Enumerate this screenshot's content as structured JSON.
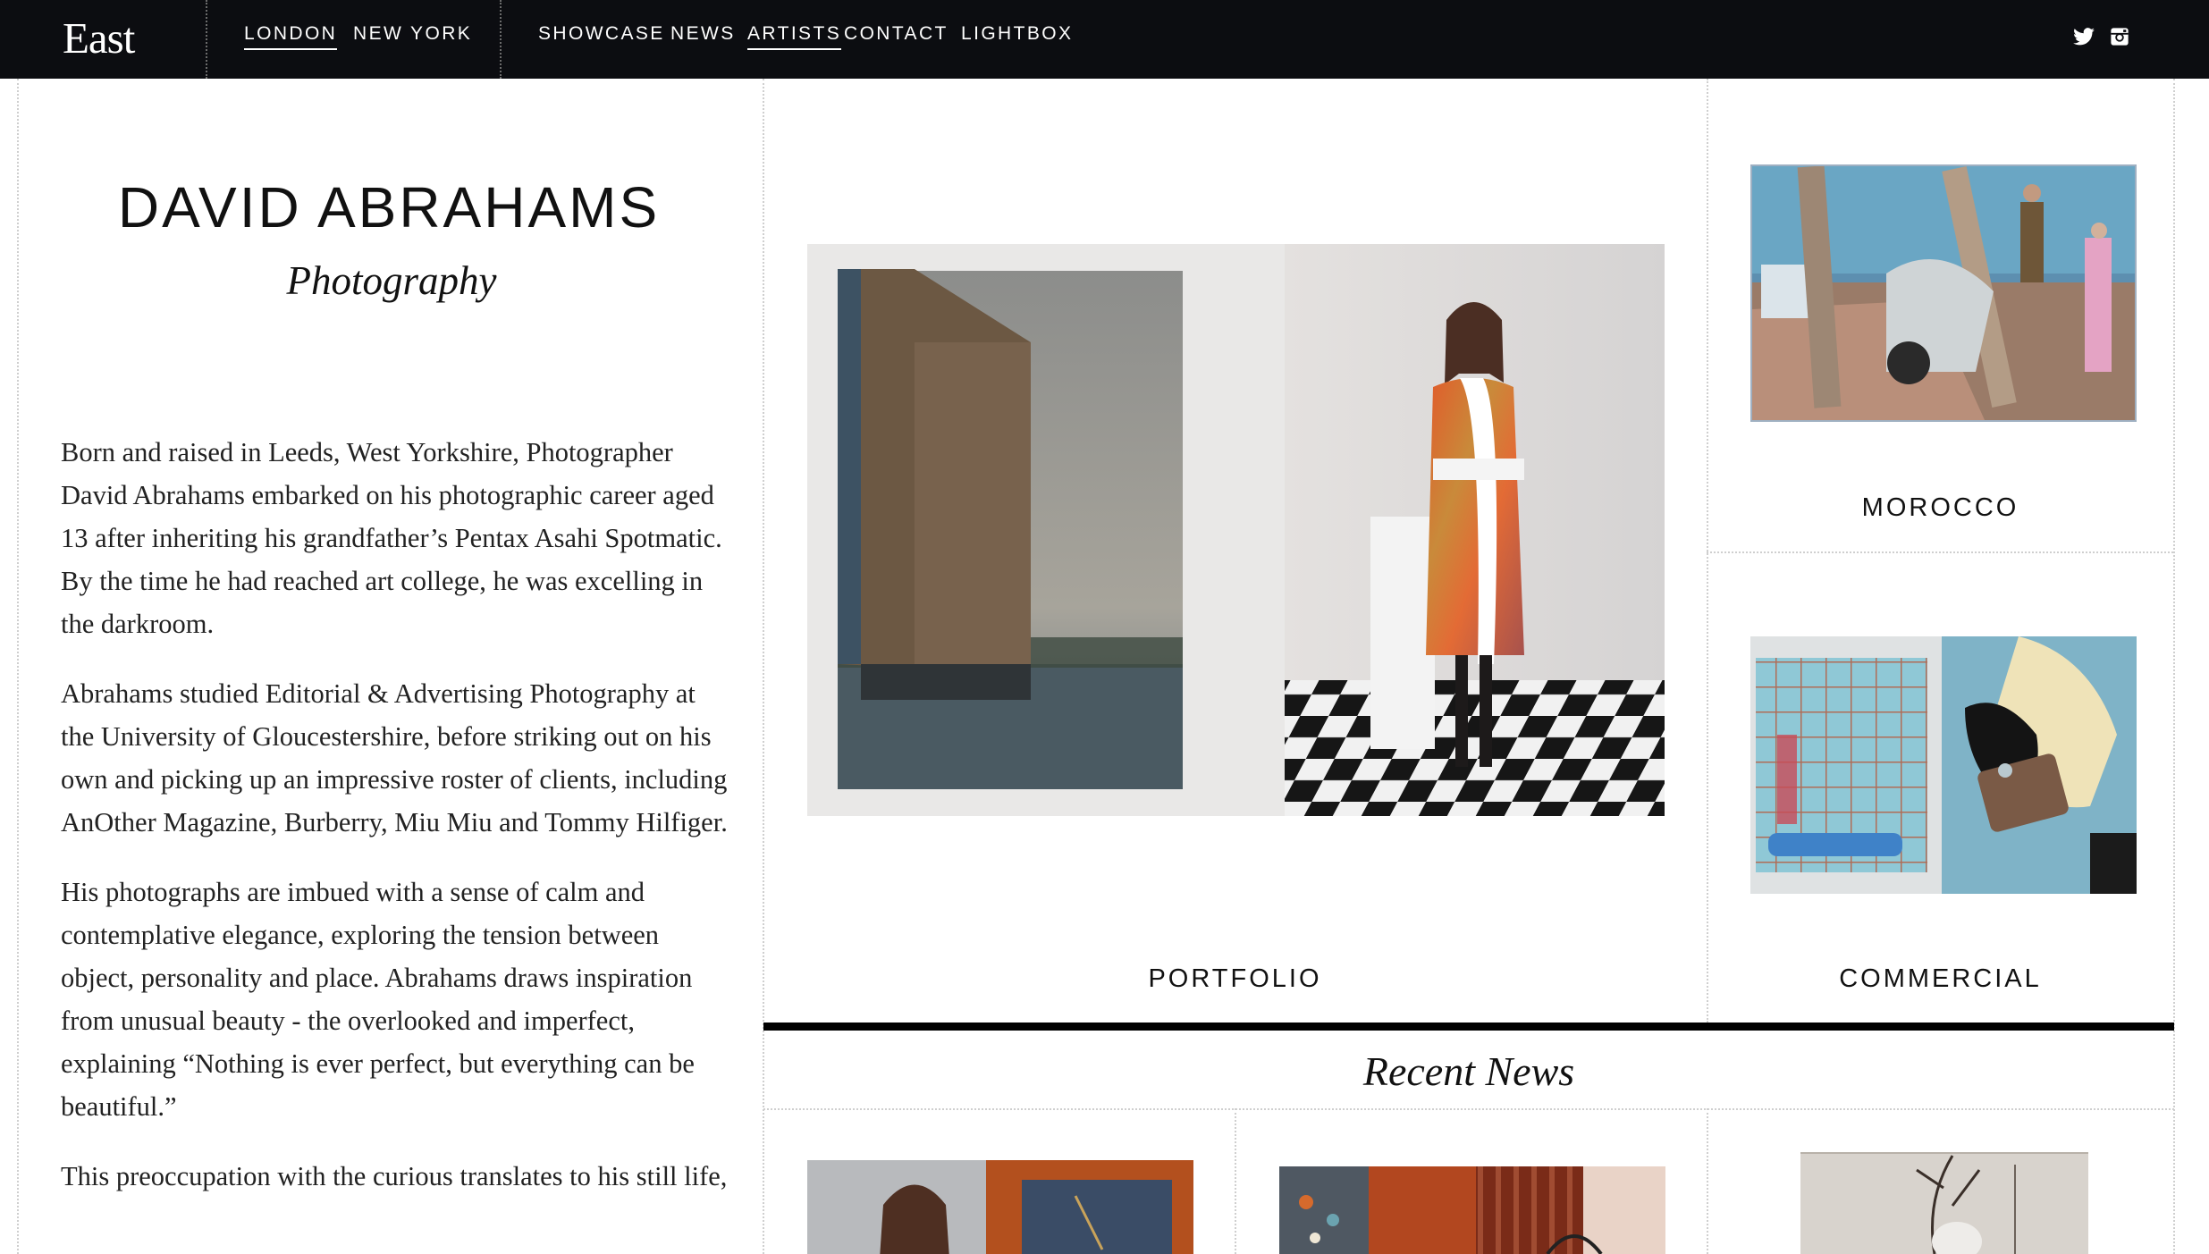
{
  "nav": {
    "logo": "East",
    "cities": [
      {
        "label": "LONDON",
        "active": true
      },
      {
        "label": "NEW YORK",
        "active": false
      }
    ],
    "links": [
      {
        "label": "SHOWCASE",
        "active": false
      },
      {
        "label": "NEWS",
        "active": false
      },
      {
        "label": "ARTISTS",
        "active": true
      },
      {
        "label": "CONTACT",
        "active": false
      },
      {
        "label": "LIGHTBOX",
        "active": false
      }
    ],
    "social": [
      "twitter-icon",
      "instagram-icon"
    ]
  },
  "artist": {
    "name": "DAVID ABRAHAMS",
    "discipline": "Photography",
    "bio": [
      "Born and raised in Leeds, West Yorkshire, Photographer David Abrahams embarked on his photographic career aged 13 after inheriting his grandfather’s Pentax Asahi Spotmatic. By the time he had reached art college, he was excelling in the darkroom.",
      "Abrahams studied Editorial & Advertising Photography at the University of Gloucestershire, before striking out on his own and picking up an impressive roster of clients, including AnOther Magazine, Burberry, Miu Miu and Tommy Hilfiger.",
      "His photographs are imbued with a sense of calm and contemplative elegance, exploring the tension between object, personality and place. Abrahams draws inspiration from unusual beauty - the overlooked and imperfect, explaining “Nothing is ever perfect, but everything can be beautiful.”",
      "This preoccupation with the curious translates to his still life,"
    ]
  },
  "galleries": {
    "portfolio": "PORTFOLIO",
    "morocco": "MOROCCO",
    "commercial": "COMMERCIAL"
  },
  "news": {
    "heading": "Recent News"
  },
  "colors": {
    "nav_bg": "#0c0d11",
    "rule": "#000000",
    "grid_dots": "#cfcfcf"
  }
}
